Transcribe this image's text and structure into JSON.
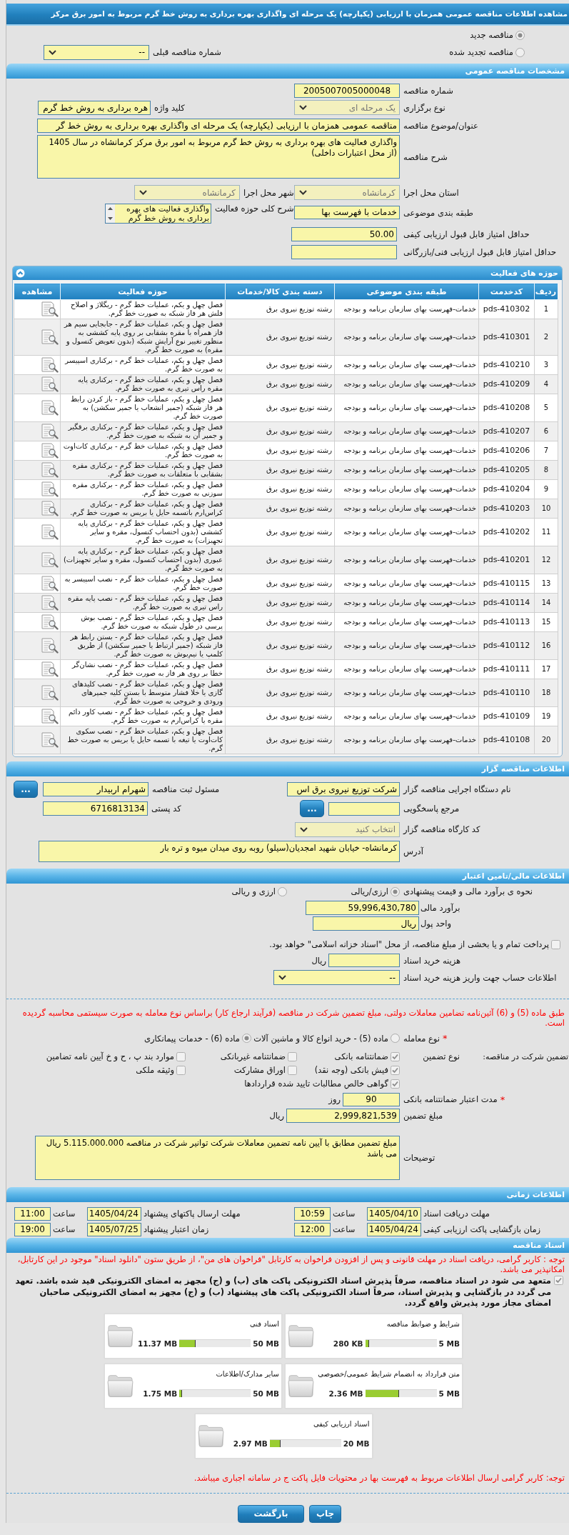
{
  "title": "مشاهده اطلاعات مناقصه عمومی همزمان با ارزیابی (یکپارچه) یک مرحله ای واگذاری بهره برداری به روش خط گرم مربوط به امور برق مرکز",
  "tender_status": [
    {
      "label": "مناقصه جدید",
      "selected": true
    },
    {
      "label": "مناقصه تجدید شده",
      "selected": false
    }
  ],
  "previous_tender": {
    "label": "شماره مناقصه قبلی",
    "value": "--",
    "disabled": false
  },
  "general": {
    "heading": "مشخصات مناقصه عمومی",
    "tender_number": {
      "label": "شماره مناقصه",
      "value": "2005007005000048"
    },
    "holding_type": {
      "label": "نوع برگزاری",
      "value": "یک مرحله ای",
      "disabled": true
    },
    "keyword": {
      "label": "کلید واژه",
      "value": "هره برداری به روش خط گرم"
    },
    "subject": {
      "label": "عنوان/موضوع مناقصه",
      "value": "مناقصه عمومی همزمان با ارزیابی (یکپارچه) یک مرحله ای واگذاری بهره برداری به روش خط گر"
    },
    "description": {
      "label": "شرح مناقصه",
      "value": "واگذاری فعالیت های بهره برداری به روش خط گرم مربوط به امور برق مرکز کرمانشاه  در سال 1405 (از محل اعتبارات داخلی)"
    },
    "province": {
      "label": "استان محل اجرا",
      "value": "کرمانشاه",
      "disabled": true
    },
    "city": {
      "label": "شهر محل اجرا",
      "value": "کرمانشاه",
      "disabled": true
    },
    "category": {
      "label": "طبقه بندی موضوعی",
      "value": "خدمات با فهرست بها"
    },
    "activity_scope": {
      "label": "شرح کلی حوزه فعالیت",
      "value": "واگذاری فعالیت های بهره برداری به روش خط گرم"
    },
    "min_quality_score": {
      "label": "حداقل امتیاز قابل قبول ارزیابی کیفی",
      "value": "50.00"
    },
    "min_technical_score": {
      "label": "حداقل امتیاز قابل قبول ارزیابی فنی/بازرگانی"
    }
  },
  "activities": {
    "heading": "حوزه های فعالیت",
    "expanded": true,
    "columns": [
      "ردیف",
      "کدخدمت",
      "طبقه بندی موضوعی",
      "دسته بندی کالا/خدمات",
      "حوزه فعالیت",
      "مشاهده"
    ],
    "rows": [
      {
        "index": "1",
        "code": "pds-410302",
        "category": "خدمات-فهرست بهای سازمان برنامه و بودجه",
        "group": "رشته توزیع نیروی برق",
        "activity": "فصل چهل و یکم، عملیات خط گرم - ریگلاژ و اصلاح فلش هر فاز شبکه به صورت خط گرم."
      },
      {
        "index": "2",
        "code": "pds-410301",
        "category": "خدمات-فهرست بهای سازمان برنامه و بودجه",
        "group": "رشته توزیع نیروی برق",
        "activity": "فصل چهل و یکم، عملیات خط گرم - جابجایی سیم هر فاز همراه با مقره بشقابی بر روی پایه کششی به منظور تغییر نوع آرایش شبکه (بدون تعویض کنسول و مقره) به صورت خط گرم."
      },
      {
        "index": "3",
        "code": "pds-410210",
        "category": "خدمات-فهرست بهای سازمان برنامه و بودجه",
        "group": "رشته توزیع نیروی برق",
        "activity": "فصل چهل و یکم، عملیات خط گرم - برکناری اسپیسر به صورت خط گرم."
      },
      {
        "index": "4",
        "code": "pds-410209",
        "category": "خدمات-فهرست بهای سازمان برنامه و بودجه",
        "group": "رشته توزیع نیروی برق",
        "activity": "فصل چهل و یکم، عملیات خط گرم - برکناری پایه مقره راس تیری به صورت خط گرم."
      },
      {
        "index": "5",
        "code": "pds-410208",
        "category": "خدمات-فهرست بهای سازمان برنامه و بودجه",
        "group": "رشته توزیع نیروی برق",
        "activity": "فصل چهل و یکم، عملیات خط گرم - باز کردن رابط هر فاز شبکه (جمپر انشعاب یا جمپر سکشن) به صورت خط گرم."
      },
      {
        "index": "6",
        "code": "pds-410207",
        "category": "خدمات-فهرست بهای سازمان برنامه و بودجه",
        "group": "رشته توزیع نیروی برق",
        "activity": "فصل چهل و یکم، عملیات خط گرم - برکناری برقگیر و جمپر آن به شبکه به صورت خط گرم."
      },
      {
        "index": "7",
        "code": "pds-410206",
        "category": "خدمات-فهرست بهای سازمان برنامه و بودجه",
        "group": "رشته توزیع نیروی برق",
        "activity": "فصل چهل و یکم، عملیات خط گرم - برکناری کات‌اوت به صورت خط گرم."
      },
      {
        "index": "8",
        "code": "pds-410205",
        "category": "خدمات-فهرست بهای سازمان برنامه و بودجه",
        "group": "رشته توزیع نیروی برق",
        "activity": "فصل چهل و یکم، عملیات خط گرم - برکناری مقره بشقابی با متعلقات به صورت خط گرم."
      },
      {
        "index": "9",
        "code": "pds-410204",
        "category": "خدمات-فهرست بهای سازمان برنامه و بودجه",
        "group": "رشته توزیع نیروی برق",
        "activity": "فصل چهل و یکم، عملیات خط گرم - برکناری مقره سوزنی به صورت خط گرم."
      },
      {
        "index": "10",
        "code": "pds-410203",
        "category": "خدمات-فهرست بهای سازمان برنامه و بودجه",
        "group": "رشته توزیع نیروی برق",
        "activity": "فصل چهل و یکم، عملیات خط گرم - برکناری کراس‌ارم باتسمه حایل یا بریس به صورت خط گرم."
      },
      {
        "index": "11",
        "code": "pds-410202",
        "category": "خدمات-فهرست بهای سازمان برنامه و بودجه",
        "group": "رشته توزیع نیروی برق",
        "activity": "فصل چهل و یکم، عملیات خط گرم - برکناری پایه کششی (بدون احتساب کنسول، مقره و سایر تجهیزات) به صورت خط گرم."
      },
      {
        "index": "12",
        "code": "pds-410201",
        "category": "خدمات-فهرست بهای سازمان برنامه و بودجه",
        "group": "رشته توزیع نیروی برق",
        "activity": "فصل چهل و یکم، عملیات خط گرم - برکناری پایه عبوری (بدون احتساب کنسول، مقره و سایر تجهیزات) به صورت خط گرم."
      },
      {
        "index": "13",
        "code": "pds-410115",
        "category": "خدمات-فهرست بهای سازمان برنامه و بودجه",
        "group": "رشته توزیع نیروی برق",
        "activity": "فصل چهل و یکم، عملیات خط گرم - نصب اسپیسر به صورت خط گرم."
      },
      {
        "index": "14",
        "code": "pds-410114",
        "category": "خدمات-فهرست بهای سازمان برنامه و بودجه",
        "group": "رشته توزیع نیروی برق",
        "activity": "فصل چهل و یکم، عملیات خط گرم - نصب پایه مقره راس تیری به صورت  خط گرم."
      },
      {
        "index": "15",
        "code": "pds-410113",
        "category": "خدمات-فهرست بهای سازمان برنامه و بودجه",
        "group": "رشته توزیع نیروی برق",
        "activity": "فصل چهل و یکم، عملیات خط گرم - نصب بوش پرسی در طول شبکه به صورت خط گرم."
      },
      {
        "index": "16",
        "code": "pds-410112",
        "category": "خدمات-فهرست بهای سازمان برنامه و بودجه",
        "group": "رشته توزیع نیروی برق",
        "activity": "فصل چهل و یکم، عملیات خط گرم - بستن رابط هر فاز شبکه (جمپر ارتباط یا جمپر سکشن) از طریق کلمپ یا نیم‌بوش به صورت خط گرم."
      },
      {
        "index": "17",
        "code": "pds-410111",
        "category": "خدمات-فهرست بهای سازمان برنامه و بودجه",
        "group": "رشته توزیع نیروی برق",
        "activity": "فصل چهل و یکم، عملیات خط گرم - نصب نشان‌گر خطا بر روی هر فاز به صورت خط گرم."
      },
      {
        "index": "18",
        "code": "pds-410110",
        "category": "خدمات-فهرست بهای سازمان برنامه و بودجه",
        "group": "رشته توزیع نیروی برق",
        "activity": "فصل چهل و یکم، عملیات خط گرم - نصب کلیدهای گازی یا خلا فشار متوسط با بستن کلیه جمپرهای ورودی و خروجی به صورت خط گرم."
      },
      {
        "index": "19",
        "code": "pds-410109",
        "category": "خدمات-فهرست بهای سازمان برنامه و بودجه",
        "group": "رشته توزیع نیروی برق",
        "activity": "فصل چهل و یکم، عملیات خط گرم - نصب کاور دائم مقره یا کراس‌ارم به صورت خط گرم."
      },
      {
        "index": "20",
        "code": "pds-410108",
        "category": "خدمات-فهرست بهای سازمان برنامه و بودجه",
        "group": "رشته توزیع نیروی برق",
        "activity": "فصل چهل و یکم، عملیات خط گرم - نصب سکوی کات‌اوت یا تیغه با تسمه حایل یا بریس به صورت خط گرم."
      }
    ]
  },
  "organizer": {
    "heading": "اطلاعات مناقصه گزار",
    "agency": {
      "label": "نام دستگاه اجرایی مناقصه گزار",
      "value": "شرکت توزیع نیروی برق اس"
    },
    "registrar": {
      "label": "مسئول ثبت مناقصه",
      "value": "شهرام اربیدار",
      "button": "..."
    },
    "reference": {
      "label": "مرجع پاسخگویی",
      "button": "..."
    },
    "postal_code": {
      "label": "کد پستی",
      "value": "6716813134"
    },
    "workshop_code": {
      "label": "کد کارگاه مناقصه گزار",
      "value": "انتخاب کنید",
      "disabled": true
    },
    "address": {
      "label": "آدرس",
      "value": "کرمانشاه- خیابان شهید امجدیان(سیلو) روبه روی میدان میوه و تره بار"
    }
  },
  "finance": {
    "heading": "اطلاعات مالی/تامین اعتبار",
    "estimate_method": {
      "label": "نحوه ی برآورد مالی و قیمت پیشنهادی",
      "options": [
        {
          "label": "ارزی/ریالی",
          "selected": true
        },
        {
          "label": "ارزی و ریالی",
          "selected": false
        }
      ]
    },
    "estimate": {
      "label": "برآورد مالی",
      "value": "59,996,430,780"
    },
    "currency": {
      "label": "واحد پول",
      "value": "ریال"
    },
    "treasury_payment": {
      "label": "پرداخت تمام و یا بخشی از مبلغ مناقصه، از محل \"اسناد خزانه اسلامی\" خواهد بود.",
      "checked": false
    },
    "document_fee": {
      "label": "هزینه خرید اسناد",
      "unit": "ریال"
    },
    "fee_account": {
      "label": "اطلاعات حساب جهت واریز هزینه خرید اسناد",
      "value": "--",
      "disabled": false
    }
  },
  "guarantee": {
    "note": "طبق ماده (5) و (6) آئین‌نامه تضامین معاملات دولتی، مبلغ تضمین شرکت در مناقصه (فرآیند ارجاع کار) براساس نوع معامله به صورت سیستمی محاسبه گردیده است.",
    "deal_type": {
      "label": "نوع معامله",
      "required_mark": "*",
      "options": [
        {
          "label": "ماده (5) - خرید انواع کالا و ماشین آلات",
          "selected": false
        },
        {
          "label": "ماده (6) - خدمات پیمانکاری",
          "selected": true
        }
      ]
    },
    "section_label": "تضمین شرکت در مناقصه:",
    "type_label": "نوع تضمین",
    "types": [
      {
        "label": "ضمانتنامه بانکی",
        "checked": true
      },
      {
        "label": "ضمانتنامه غیربانکی",
        "checked": false
      },
      {
        "label": "موارد بند پ ، ح و خ آیین نامه تضامین",
        "checked": false
      },
      {
        "label": "فیش بانکی (وجه نقد)",
        "checked": true
      },
      {
        "label": "اوراق مشارکت",
        "checked": false
      },
      {
        "label": "وثیقه ملکی",
        "checked": false
      },
      {
        "label": "گواهی خالص مطالبات تایید شده قراردادها",
        "checked": true
      }
    ],
    "validity": {
      "label": "مدت اعتبار ضمانتنامه بانکی",
      "required_mark": "*",
      "value": "90",
      "unit": "روز"
    },
    "amount": {
      "label": "مبلغ تضمین",
      "value": "2,999,821,539",
      "unit": "ریال"
    },
    "notes": {
      "label": "توضیحات",
      "value": "مبلغ تضمین مطابق با آیین نامه تضمین معاملات شرکت توانیر شرکت در مناقصه 5.115.000.000 ریال می باشد"
    }
  },
  "timing": {
    "heading": "اطلاعات زمانی",
    "items": [
      {
        "label": "مهلت دریافت اسناد",
        "date": "1405/04/10",
        "time_label": "ساعت",
        "time": "10:59"
      },
      {
        "label": "مهلت ارسال پاکتهای پیشنهاد",
        "date": "1405/04/24",
        "time_label": "ساعت",
        "time": "11:00"
      },
      {
        "label": "زمان بازگشایی پاکت ارزیابی کیفی",
        "date": "1405/04/24",
        "time_label": "ساعت",
        "time": "12:00"
      },
      {
        "label": "زمان اعتبار پیشنهاد",
        "date": "1405/07/25",
        "time_label": "ساعت",
        "time": "19:00"
      }
    ]
  },
  "documents": {
    "heading": "اسناد مناقصه",
    "notice": "توجه : کاربر گرامی، دریافت اسناد در مهلت قانونی و پس از افزودن فراخوان به کارتابل \"فراخوان های من\"، از طریق ستون \"دانلود اسناد\" موجود در این کارتابل، امکانپذیر می باشد.",
    "commitment": {
      "text": "متعهد می شود در اسناد مناقصه، صرفاً پذیرش اسناد الکترونیکی پاکت های (ب) و (ج) مجهز به امضای الکترونیکی قید شده باشد. تعهد می گردد در بازگشایی و پذیرش اسناد، صرفاً اسناد الکترونیکی پاکت های پیشنهاد (ب) و (ج) مجهز به امضای الکترونیکی صاحبان امضای مجاز مورد پذیرش واقع گردد.",
      "checked": true
    },
    "files": [
      {
        "title": "شرایط و ضوابط مناقصه",
        "max": "5 MB",
        "used": "280 KB",
        "level": 0.055
      },
      {
        "title": "اسناد فنی",
        "max": "50 MB",
        "used": "11.37 MB",
        "level": 0.23
      },
      {
        "title": "متن قرارداد به انضمام شرایط عمومی/خصوصی",
        "max": "5 MB",
        "used": "2.36 MB",
        "level": 0.47
      },
      {
        "title": "سایر مدارک/اطلاعات",
        "max": "50 MB",
        "used": "1.75 MB",
        "level": 0.035
      },
      {
        "title": "اسناد ارزیابی کیفی",
        "max": "20 MB",
        "used": "2.97 MB",
        "level": 0.15
      }
    ],
    "footer_note": "توجه: کاربر گرامی ارسال اطلاعات مربوط به فهرست بها در محتویات فایل پاکت ج در سامانه اجباری میباشد."
  },
  "buttons": [
    "چاپ",
    "بازگشت"
  ]
}
